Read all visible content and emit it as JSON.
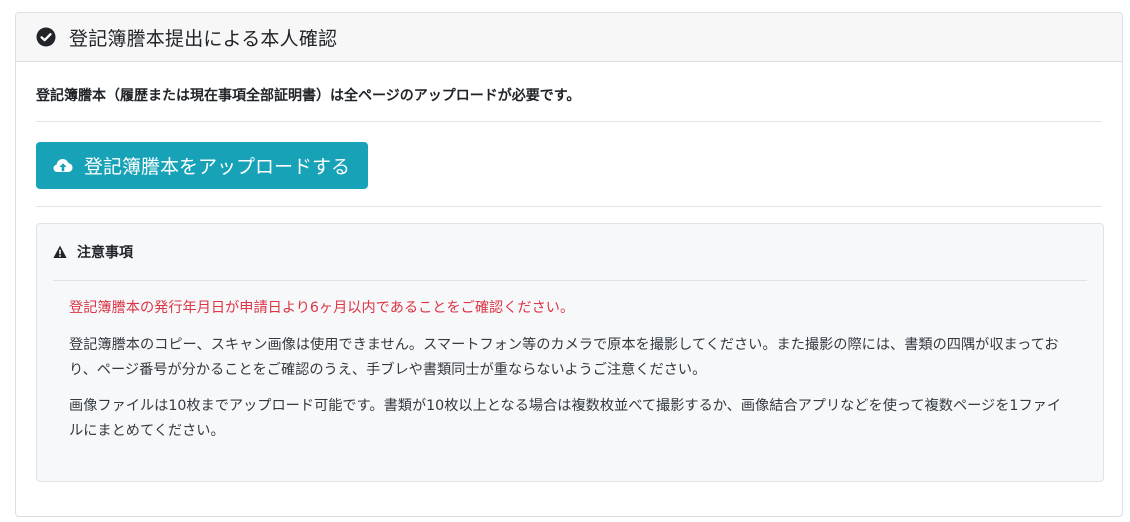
{
  "card": {
    "title": "登記簿謄本提出による本人確認",
    "check_icon": "check-circle-icon"
  },
  "lead": {
    "text": "登記簿謄本（履歴または現在事項全部証明書）は全ページのアップロードが必要です。"
  },
  "upload": {
    "label": "登記簿謄本をアップロードする",
    "icon": "cloud-upload-icon",
    "color": "#17a2b8"
  },
  "notice": {
    "title": "注意事項",
    "icon": "warning-icon",
    "highlight": "登記簿謄本の発行年月日が申請日より6ヶ月以内であることをご確認ください。",
    "highlight_color": "#dc3545",
    "paragraph1": "登記簿謄本のコピー、スキャン画像は使用できません。スマートフォン等のカメラで原本を撮影してください。また撮影の際には、書類の四隅が収まっており、ページ番号が分かることをご確認のうえ、手ブレや書類同士が重ならないようご注意ください。",
    "paragraph2": "画像ファイルは10枚までアップロード可能です。書類が10枚以上となる場合は複数枚並べて撮影するか、画像結合アプリなどを使って複数ページを1ファイルにまとめてください。"
  }
}
